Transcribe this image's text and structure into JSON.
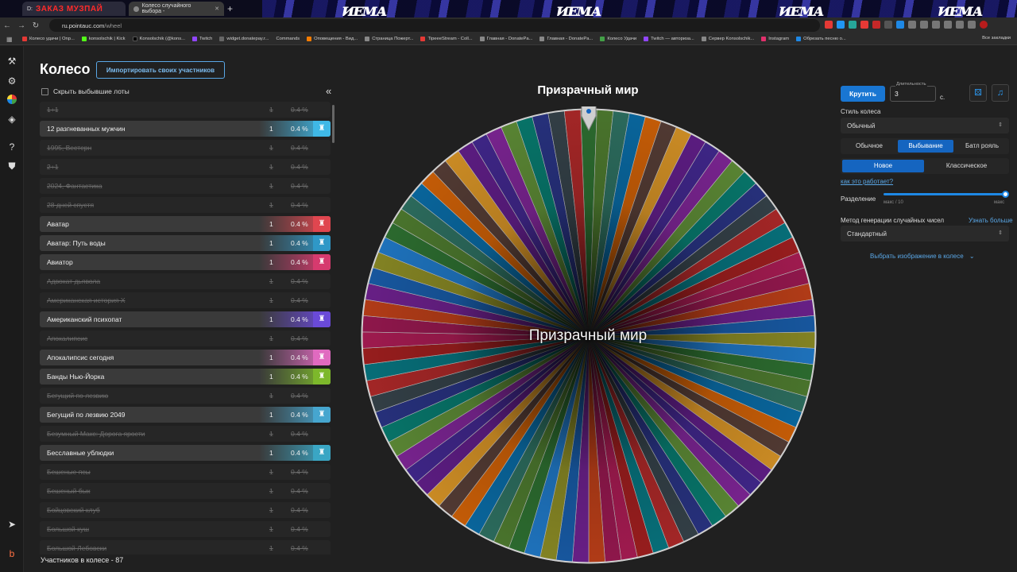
{
  "browser": {
    "tabs": [
      {
        "label": "ЗАКАЗ МУЗПАЙ",
        "prefix": "D:"
      },
      {
        "label": "Колесо случайного выбора -"
      }
    ],
    "url_domain": "ru.pointauc.com",
    "url_path": "/wheel",
    "bookmarks": [
      "Колесо удачи | Onp...",
      "konsolschik | Kick",
      "Konsolschik (@kons...",
      "Twitch",
      "widget.donatepay.r...",
      "Commands",
      "Оповещения - Вид...",
      "Страница Пожерт...",
      "TipeeeStream - Coll...",
      "Главная - DonatePa...",
      "Главная - DonatePa...",
      "Колесо Удачи",
      "Twitch — авториза...",
      "Сервер Konsolschik...",
      "Instagram",
      "Обрезать песню о..."
    ],
    "bookmarks_right": "Все закладки"
  },
  "header": {
    "title": "Колесо",
    "import_label": "Импортировать своих участников",
    "hide_label": "Скрыть выбывшие лоты",
    "collapse_icon": "«"
  },
  "lots": [
    {
      "name": "1+1",
      "amount": "1",
      "pct": "0.4 %",
      "active": false
    },
    {
      "name": "12 разгневанных мужчин",
      "amount": "1",
      "pct": "0.4 %",
      "active": true,
      "color": "#3fb8e6"
    },
    {
      "name": "1995, Вестерн",
      "amount": "1",
      "pct": "0.4 %",
      "active": false
    },
    {
      "name": "2+1",
      "amount": "1",
      "pct": "0.4 %",
      "active": false
    },
    {
      "name": "2024, Фантастика",
      "amount": "1",
      "pct": "0.4 %",
      "active": false
    },
    {
      "name": "28 дней спустя",
      "amount": "1",
      "pct": "0.4 %",
      "active": false
    },
    {
      "name": "Аватар",
      "amount": "1",
      "pct": "0.4 %",
      "active": true,
      "color": "#e0464f"
    },
    {
      "name": "Аватар: Путь воды",
      "amount": "1",
      "pct": "0.4 %",
      "active": true,
      "color": "#2f98c7"
    },
    {
      "name": "Авиатор",
      "amount": "1",
      "pct": "0.4 %",
      "active": true,
      "color": "#d63a6e"
    },
    {
      "name": "Адвокат дьявола",
      "amount": "1",
      "pct": "0.4 %",
      "active": false
    },
    {
      "name": "Американская история Х",
      "amount": "1",
      "pct": "0.4 %",
      "active": false
    },
    {
      "name": "Американский психопат",
      "amount": "1",
      "pct": "0.4 %",
      "active": true,
      "color": "#6a4ad8"
    },
    {
      "name": "Апокалипсис",
      "amount": "1",
      "pct": "0.4 %",
      "active": false
    },
    {
      "name": "Апокалипсис сегодня",
      "amount": "1",
      "pct": "0.4 %",
      "active": true,
      "color": "#e06ac0"
    },
    {
      "name": "Банды Нью-Йорка",
      "amount": "1",
      "pct": "0.4 %",
      "active": true,
      "color": "#7db82b"
    },
    {
      "name": "Бегущий по лезвию",
      "amount": "1",
      "pct": "0.4 %",
      "active": false
    },
    {
      "name": "Бегущий по лезвию 2049",
      "amount": "1",
      "pct": "0.4 %",
      "active": true,
      "color": "#46a6cf"
    },
    {
      "name": "Безумный Макс: Дорога ярости",
      "amount": "1",
      "pct": "0.4 %",
      "active": false
    },
    {
      "name": "Бесславные ублюдки",
      "amount": "1",
      "pct": "0.4 %",
      "active": true,
      "color": "#3aa6c4"
    },
    {
      "name": "Бешеные псы",
      "amount": "1",
      "pct": "0.4 %",
      "active": false
    },
    {
      "name": "Бешеный бык",
      "amount": "1",
      "pct": "0.4 %",
      "active": false
    },
    {
      "name": "Бойцовский клуб",
      "amount": "1",
      "pct": "0.4 %",
      "active": false
    },
    {
      "name": "Большой куш",
      "amount": "1",
      "pct": "0.4 %",
      "active": false
    },
    {
      "name": "Большой Лебовски",
      "amount": "1",
      "pct": "0.4 %",
      "active": false
    }
  ],
  "footer": {
    "count_label": "Участников в колесе - 87"
  },
  "wheel": {
    "title": "Призрачный мир",
    "center_text": "Призрачный мир",
    "segments": 87,
    "palette": [
      "#2e7d32",
      "#6a1b9a",
      "#c62828",
      "#1565c0",
      "#ef6c00",
      "#00897b",
      "#ad1457",
      "#558b2f",
      "#4527a0",
      "#00838f",
      "#9e9d24",
      "#5d4037",
      "#283593",
      "#d84315",
      "#2e7d6b",
      "#8e24aa",
      "#b71c1c",
      "#1e88e5",
      "#f9a825",
      "#37474f",
      "#7b1fa2",
      "#0277bd",
      "#689f38",
      "#c2185b"
    ]
  },
  "controls": {
    "spin_label": "Крутить",
    "duration_label": "Длительность",
    "duration_value": "3",
    "duration_unit": "с.",
    "style_label": "Стиль колеса",
    "style_value": "Обычный",
    "mode_options": [
      "Обычное",
      "Выбывание",
      "Батл рояль"
    ],
    "mode_active": "Выбывание",
    "variant_options": [
      "Новое",
      "Классическое"
    ],
    "variant_active": "Новое",
    "how_link": "как это работает?",
    "split_label": "Разделение",
    "split_min": "макс / 10",
    "split_max": "макс",
    "split_level": 1.0,
    "rng_label": "Метод генерации случайных чисел",
    "rng_link": "Узнать больше",
    "rng_value": "Стандартный",
    "image_link": "Выбрать изображение в колесе"
  }
}
